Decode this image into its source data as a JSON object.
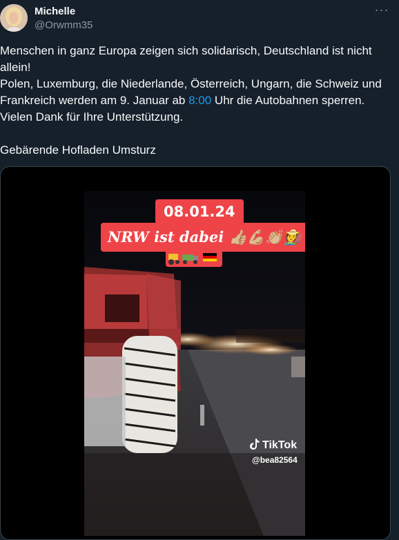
{
  "author": {
    "name": "Michelle",
    "handle": "@Orwmm35"
  },
  "more_icon": "more-options-icon",
  "tweet": {
    "line1": "Menschen in ganz Europa zeigen sich solidarisch, Deutschland ist nicht allein!",
    "line2": "Polen, Luxemburg, die Niederlande, Österreich, Ungarn, die Schweiz und Frankreich werden am 9. Januar ab ",
    "time_link": "8:00",
    "line2_end": " Uhr die Autobahnen sperren.",
    "line3": "Vielen Dank für Ihre Unterstützung.",
    "line4": "Gebärende Hofladen Umsturz"
  },
  "video": {
    "date_banner": "08.01.24",
    "nrw_banner": "NRW ist dabei 👍🏼💪🏼👏🏼🧑‍🌾",
    "tiktok_label": "TikTok",
    "tiktok_user": "@bea82564"
  },
  "colors": {
    "background": "#15202b",
    "link": "#1d9bf0",
    "banner_red": "#ee4448",
    "muted": "#8b98a5"
  }
}
